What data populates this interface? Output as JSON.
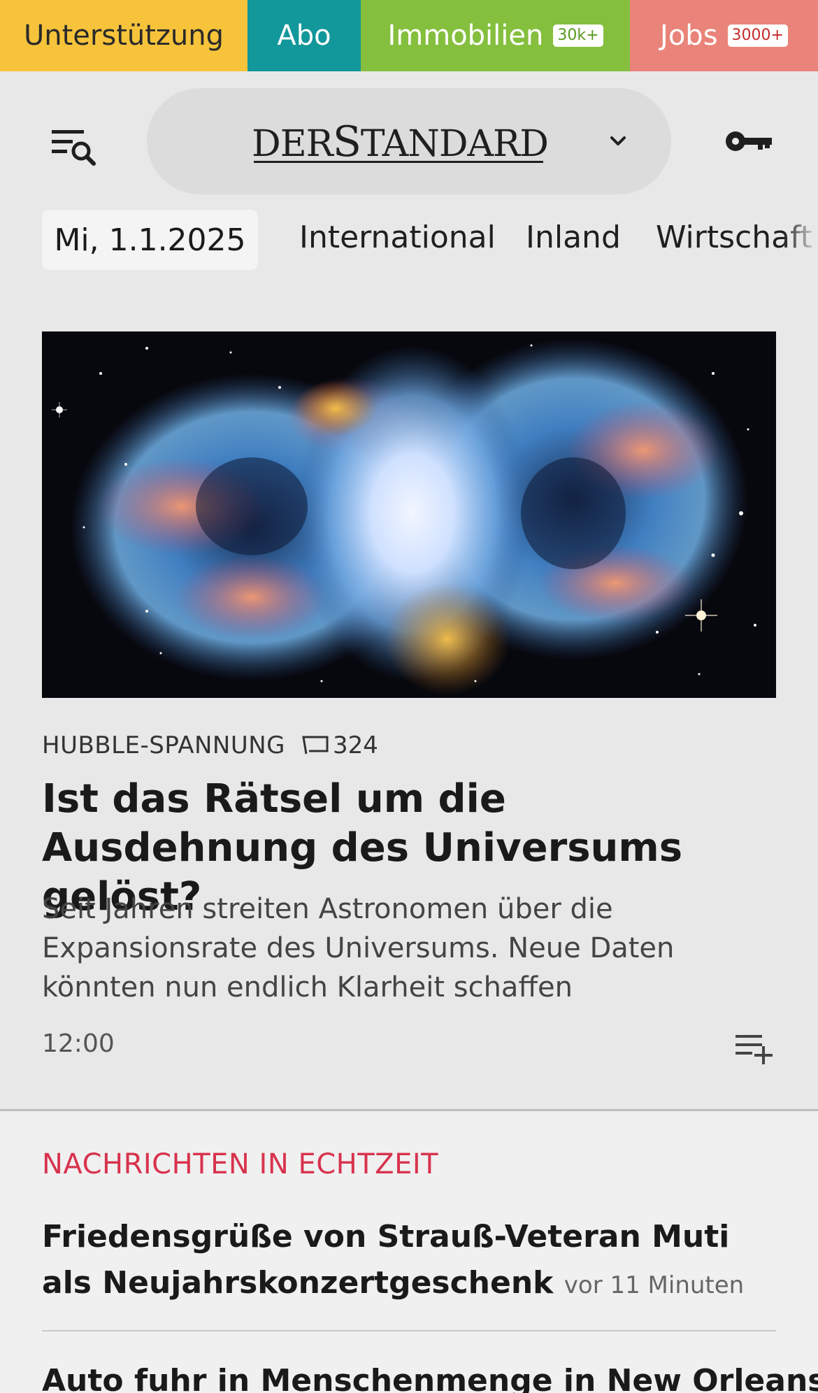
{
  "topbar": {
    "support_label": "Unterstützung",
    "abo_label": "Abo",
    "immobilien_label": "Immobilien",
    "immobilien_badge": "30k+",
    "jobs_label": "Jobs",
    "jobs_badge": "3000+"
  },
  "header": {
    "logo_part1": "DER",
    "logo_part2": "S",
    "logo_part3": "TANDARD"
  },
  "nav": {
    "date": "Mi, 1.1.2025",
    "items": [
      "International",
      "Inland",
      "Wirtschaft"
    ]
  },
  "hero": {
    "kicker": "HUBBLE-SPANNUNG",
    "comment_count": "324",
    "headline": "Ist das Rätsel um die Ausdehnung des Universums gelöst?",
    "teaser": "Seit Jahren streiten Astronomen über die Expansionsrate des Universums. Neue Daten könnten nun endlich Klarheit schaffen",
    "time": "12:00"
  },
  "realtime": {
    "title": "NACHRICHTEN IN ECHTZEIT",
    "items": [
      {
        "headline": "Friedensgrüße von Strauß-Veteran Muti als Neu­jahrskonzertgeschenk",
        "ago": "vor 11 Minuten"
      },
      {
        "headline": "Auto fuhr in Menschenmenge in New Orleans,"
      }
    ]
  },
  "colors": {
    "support": "#f6c33b",
    "abo": "#12979a",
    "immobilien": "#85bf3e",
    "jobs": "#ea8379",
    "realtime_accent": "#d8334d"
  },
  "icons": [
    "menu-search-icon",
    "chevron-down-icon",
    "key-icon",
    "comment-icon",
    "playlist-add-icon"
  ]
}
